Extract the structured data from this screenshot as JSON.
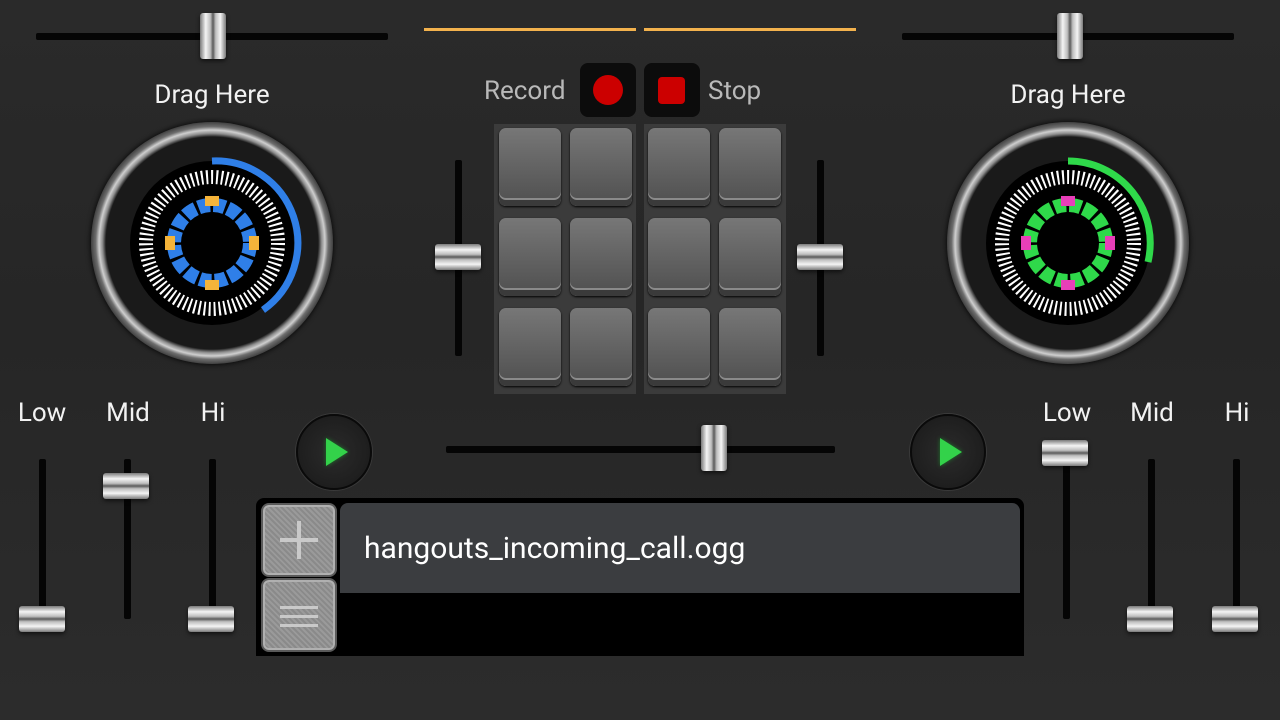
{
  "deck_left": {
    "drag_label": "Drag Here",
    "accent": "#2f7fe8",
    "marker_color": "#f5b43a",
    "eq": {
      "low": "Low",
      "mid": "Mid",
      "hi": "Hi"
    }
  },
  "deck_right": {
    "drag_label": "Drag Here",
    "accent": "#2fd94a",
    "marker_color": "#e83fb8",
    "eq": {
      "low": "Low",
      "mid": "Mid",
      "hi": "Hi"
    }
  },
  "center": {
    "record_label": "Record",
    "stop_label": "Stop",
    "record_color": "#cc0000",
    "stop_color": "#cc0000"
  },
  "playlist": {
    "current_track": "hangouts_incoming_call.ogg"
  },
  "icons": {
    "add": "plus-icon",
    "menu": "menu-lines-icon",
    "play": "play-icon"
  }
}
